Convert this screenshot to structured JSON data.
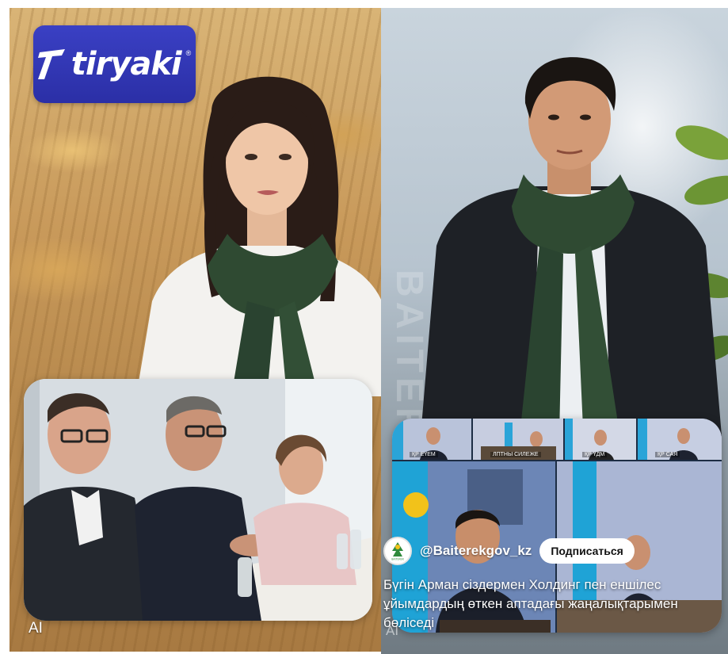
{
  "left_ad": {
    "brand": "tiryaki",
    "registered_mark": "®",
    "ai_label": "AI"
  },
  "right_ad": {
    "watermark": "BAITEREK",
    "video_tiles": [
      {
        "label": "ҚР ЕҮЕМ"
      },
      {
        "label": "ЛПТНЫ СИЛЕЖЕ"
      },
      {
        "label": ""
      },
      {
        "label": "ҚР ҮДМ"
      },
      {
        "label": "ҚР САЯ"
      }
    ],
    "account_handle": "@Baiterekgov_kz",
    "avatar_caption": "BAITEREK",
    "subscribe_label": "Подписаться",
    "caption": "Бүгін Арман сіздермен Холдинг пен еншілес ұйымдардың өткен аптадағы жаңалықтарымен бөліседі",
    "ai_label": "AI"
  },
  "colors": {
    "logo_blue": "#2f34b0",
    "scarf_green": "#2f4a32",
    "suit_dark": "#1e2126",
    "flag_blue": "#1fa3d6",
    "flag_gold": "#f2c21a"
  }
}
